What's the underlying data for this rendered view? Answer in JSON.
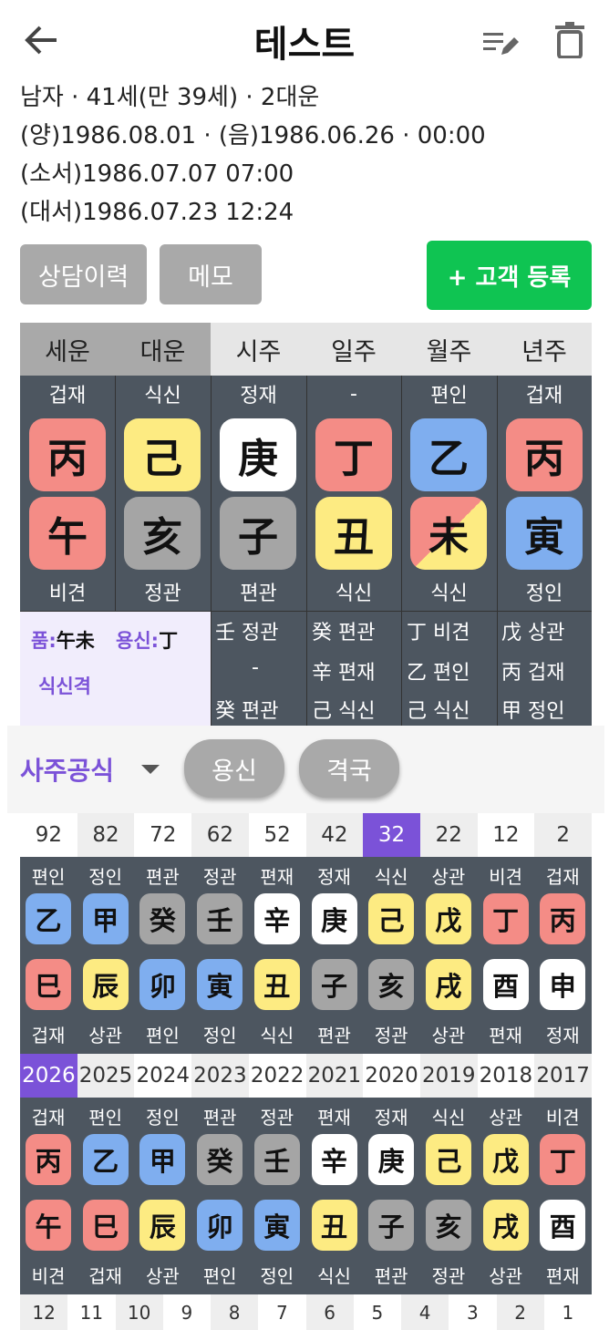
{
  "header": {
    "title": "테스트"
  },
  "info": {
    "line1": "남자 · 41세(만 39세) · 2대운",
    "line2": "(양)1986.08.01 · (음)1986.06.26 · 00:00",
    "line3": "(소서)1986.07.07 07:00",
    "line4": "(대서)1986.07.23 12:24"
  },
  "buttons": {
    "history": "상담이력",
    "memo": "메모",
    "register": "+ 고객 등록"
  },
  "tabs": {
    "seun": "세운",
    "daeun": "대운",
    "si": "시주",
    "il": "일주",
    "wol": "월주",
    "nyeon": "년주"
  },
  "pillars": [
    {
      "top": "겁재",
      "stem": "丙",
      "branch": "午",
      "bottom": "비견"
    },
    {
      "top": "식신",
      "stem": "己",
      "branch": "亥",
      "bottom": "정관"
    },
    {
      "top": "정재",
      "stem": "庚",
      "branch": "子",
      "bottom": "편관"
    },
    {
      "top": "-",
      "stem": "丁",
      "branch": "丑",
      "bottom": "식신"
    },
    {
      "top": "편인",
      "stem": "乙",
      "branch": "未",
      "bottom": "식신"
    },
    {
      "top": "겁재",
      "stem": "丙",
      "branch": "寅",
      "bottom": "정인"
    }
  ],
  "summary": {
    "pum_label": "품:",
    "pum_value": "午未",
    "yongsin_label": "용신:",
    "yongsin_value": "丁",
    "gyeok": "식신격"
  },
  "hidden": [
    [
      "壬 정관",
      "-",
      "癸 편관"
    ],
    [
      "癸 편관",
      "辛 편재",
      "己 식신"
    ],
    [
      "丁 비견",
      "乙 편인",
      "己 식신"
    ],
    [
      "戊 상관",
      "丙 겁재",
      "甲 정인"
    ]
  ],
  "formula": {
    "label": "사주공식",
    "yongsin": "용신",
    "gyeokguk": "격국"
  },
  "daeun": {
    "ages": [
      "92",
      "82",
      "72",
      "62",
      "52",
      "42",
      "32",
      "22",
      "12",
      "2"
    ],
    "stem_gods": [
      "편인",
      "정인",
      "편관",
      "정관",
      "편재",
      "정재",
      "식신",
      "상관",
      "비견",
      "겁재"
    ],
    "stems": [
      "乙",
      "甲",
      "癸",
      "壬",
      "辛",
      "庚",
      "己",
      "戊",
      "丁",
      "丙"
    ],
    "branches": [
      "巳",
      "辰",
      "卯",
      "寅",
      "丑",
      "子",
      "亥",
      "戌",
      "酉",
      "申"
    ],
    "branch_gods": [
      "겁재",
      "상관",
      "편인",
      "정인",
      "식신",
      "편관",
      "정관",
      "상관",
      "편재",
      "정재"
    ]
  },
  "seun": {
    "years": [
      "2026",
      "2025",
      "2024",
      "2023",
      "2022",
      "2021",
      "2020",
      "2019",
      "2018",
      "2017"
    ],
    "stem_gods": [
      "겁재",
      "편인",
      "정인",
      "편관",
      "정관",
      "편재",
      "정재",
      "식신",
      "상관",
      "비견"
    ],
    "stems": [
      "丙",
      "乙",
      "甲",
      "癸",
      "壬",
      "辛",
      "庚",
      "己",
      "戊",
      "丁"
    ],
    "branches": [
      "午",
      "巳",
      "辰",
      "卯",
      "寅",
      "丑",
      "子",
      "亥",
      "戌",
      "酉"
    ],
    "branch_gods": [
      "비견",
      "겁재",
      "상관",
      "편인",
      "정인",
      "식신",
      "편관",
      "정관",
      "상관",
      "편재"
    ]
  },
  "months": [
    "12",
    "11",
    "10",
    "9",
    "8",
    "7",
    "6",
    "5",
    "4",
    "3",
    "2",
    "1"
  ],
  "colors": {
    "red": "#f48c86",
    "yellow": "#fdeb82",
    "blue": "#7faeef",
    "gray": "#a5a5a5",
    "white": "#ffffff",
    "purple": "#7b52d8",
    "dark": "#4d5660",
    "green": "#0fc452"
  }
}
